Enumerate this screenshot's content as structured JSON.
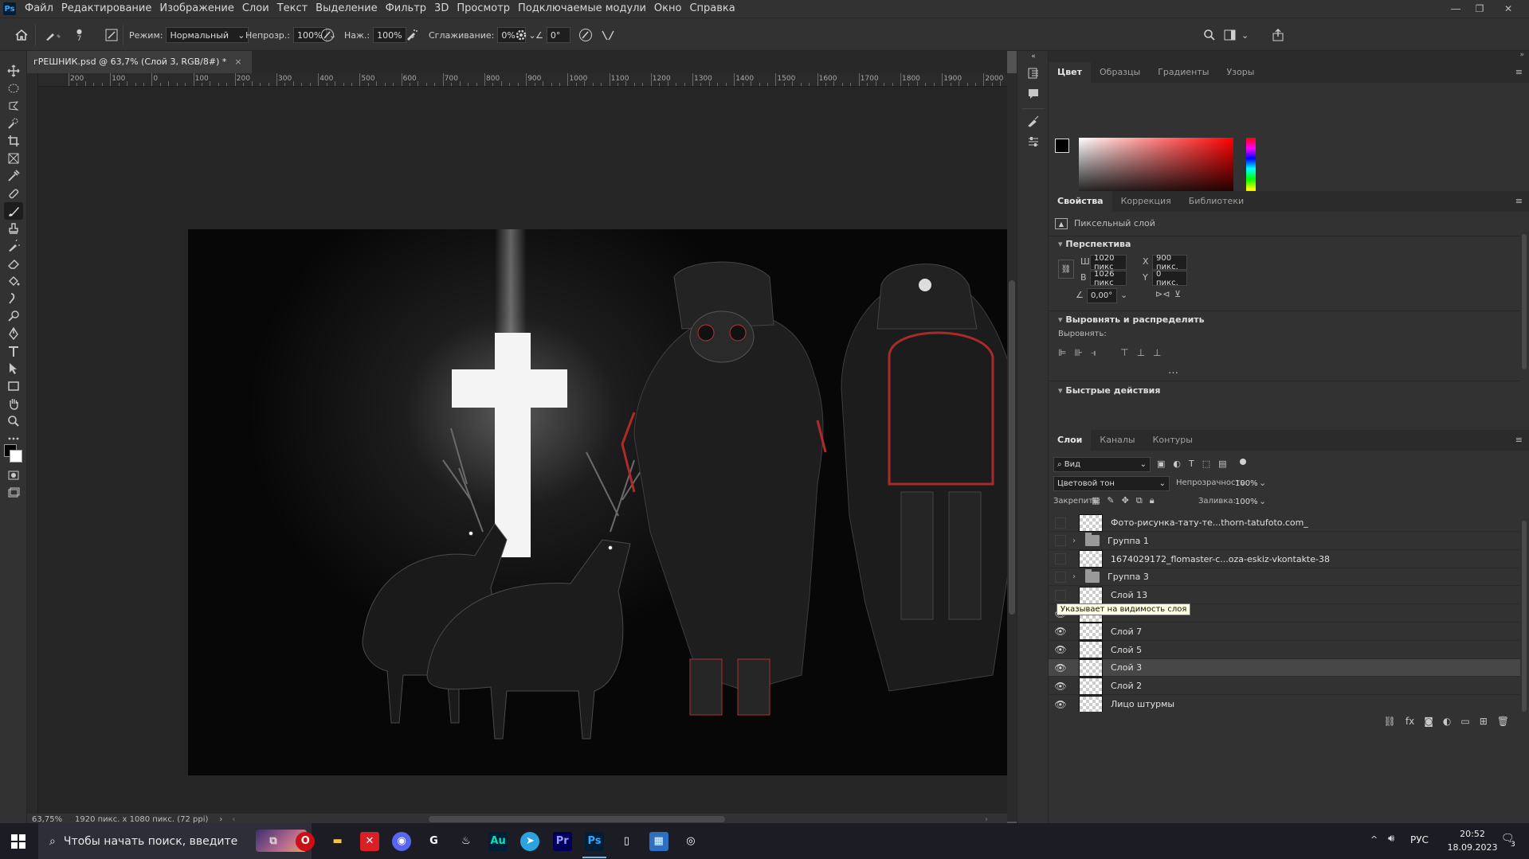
{
  "app": {
    "menu": [
      "Файл",
      "Редактирование",
      "Изображение",
      "Слои",
      "Текст",
      "Выделение",
      "Фильтр",
      "3D",
      "Просмотр",
      "Подключаемые модули",
      "Окно",
      "Справка"
    ]
  },
  "options": {
    "brush_size": "7",
    "mode_label": "Режим:",
    "mode_value": "Нормальный",
    "opacity_label": "Непрозр.:",
    "opacity_value": "100%",
    "pressure_label": "Наж.:",
    "pressure_value": "100%",
    "smoothing_label": "Сглаживание:",
    "smoothing_value": "0%",
    "angle_value": "0°"
  },
  "document": {
    "tab_title": "гРЕШНИК.psd @ 63,7% (Слой 3, RGB/8#) *",
    "ruler_labels": [
      "200",
      "100",
      "0",
      "100",
      "200",
      "300",
      "400",
      "500",
      "600",
      "700",
      "800",
      "900",
      "1000",
      "1100",
      "1200",
      "1300",
      "1400",
      "1500",
      "1600",
      "1700",
      "1800",
      "1900",
      "2000"
    ],
    "zoom": "63,75%",
    "doc_info": "1920 пикс. x 1080 пикс. (72 ppi)"
  },
  "color_panel": {
    "tabs": [
      "Цвет",
      "Образцы",
      "Градиенты",
      "Узоры"
    ]
  },
  "properties": {
    "tabs": [
      "Свойства",
      "Коррекция",
      "Библиотеки"
    ],
    "layer_kind": "Пиксельный слой",
    "transform_title": "Перспектива",
    "w_label": "Ш",
    "w_value": "1020 пикс",
    "h_label": "В",
    "h_value": "1026 пикс",
    "x_label": "X",
    "x_value": "900 пикс.",
    "y_label": "Y",
    "y_value": "0 пикс.",
    "angle_value": "0,00°",
    "align_title": "Выровнять и распределить",
    "align_label": "Выровнять:",
    "quick_title": "Быстрые действия"
  },
  "layers_panel": {
    "tabs": [
      "Слои",
      "Каналы",
      "Контуры"
    ],
    "filter_value": "Вид",
    "blend_value": "Цветовой тон",
    "opacity_label": "Непрозрачность:",
    "opacity_value": "100%",
    "lock_label": "Закрепить:",
    "fill_label": "Заливка:",
    "fill_value": "100%",
    "tooltip": "Указывает на видимость слоя",
    "layers": [
      {
        "name": "Фото-рисунка-тату-те...thorn-tatufoto.com_",
        "visible": false,
        "type": "pixel"
      },
      {
        "name": "Группа 1",
        "visible": false,
        "type": "group"
      },
      {
        "name": "1674029172_flomaster-c...oza-eskiz-vkontakte-38",
        "visible": false,
        "type": "pixel"
      },
      {
        "name": "Группа 3",
        "visible": false,
        "type": "group"
      },
      {
        "name": "Слой 13",
        "visible": false,
        "type": "pixel"
      },
      {
        "name": "",
        "visible": true,
        "type": "pixel"
      },
      {
        "name": "Слой 7",
        "visible": true,
        "type": "pixel"
      },
      {
        "name": "Слой 5",
        "visible": true,
        "type": "pixel"
      },
      {
        "name": "Слой 3",
        "visible": true,
        "type": "pixel",
        "selected": true
      },
      {
        "name": "Слой 2",
        "visible": true,
        "type": "pixel"
      },
      {
        "name": "Лицо штурмы",
        "visible": true,
        "type": "pixel"
      }
    ]
  },
  "taskbar": {
    "search_placeholder": "Чтобы начать поиск, введите",
    "lang": "РУС",
    "time": "20:52",
    "date": "18.09.2023",
    "notification_count": "3",
    "apps": [
      "task-view",
      "opera",
      "file-explorer",
      "adobe-cc",
      "discord",
      "github",
      "steam",
      "audition",
      "telegram",
      "premiere",
      "photoshop",
      "notepad",
      "calculator",
      "obs"
    ]
  },
  "colors": {
    "foreground": "#000000",
    "background": "#ffffff",
    "picker_hue": "#ff0000",
    "accent": "#31a8ff"
  }
}
